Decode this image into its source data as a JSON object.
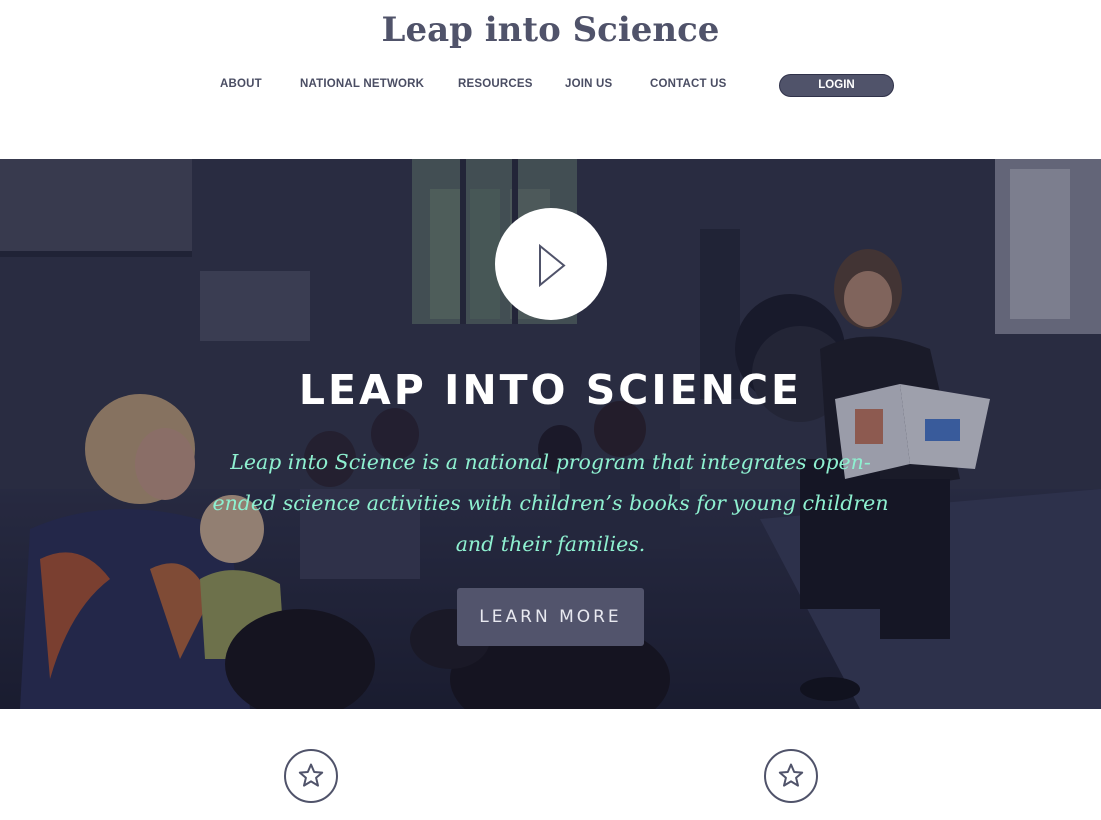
{
  "site": {
    "title": "Leap into Science"
  },
  "nav": {
    "items": [
      "ABOUT",
      "NATIONAL NETWORK",
      "RESOURCES",
      "JOIN US",
      "CONTACT US"
    ],
    "login_label": "LOGIN"
  },
  "hero": {
    "play_icon": "play-icon",
    "heading": "LEAP INTO SCIENCE",
    "description": "Leap into Science is a national program that integrates open-ended science activities with children’s books for young children and their families.",
    "cta_label": "LEARN MORE",
    "colors": {
      "heading": "#ffffff",
      "description": "#8ef0d0",
      "cta_background": "#52546c"
    }
  },
  "features": {
    "icons": [
      "star-icon",
      "star-icon"
    ]
  },
  "colors": {
    "brand": "#50536a",
    "background": "#ffffff"
  }
}
